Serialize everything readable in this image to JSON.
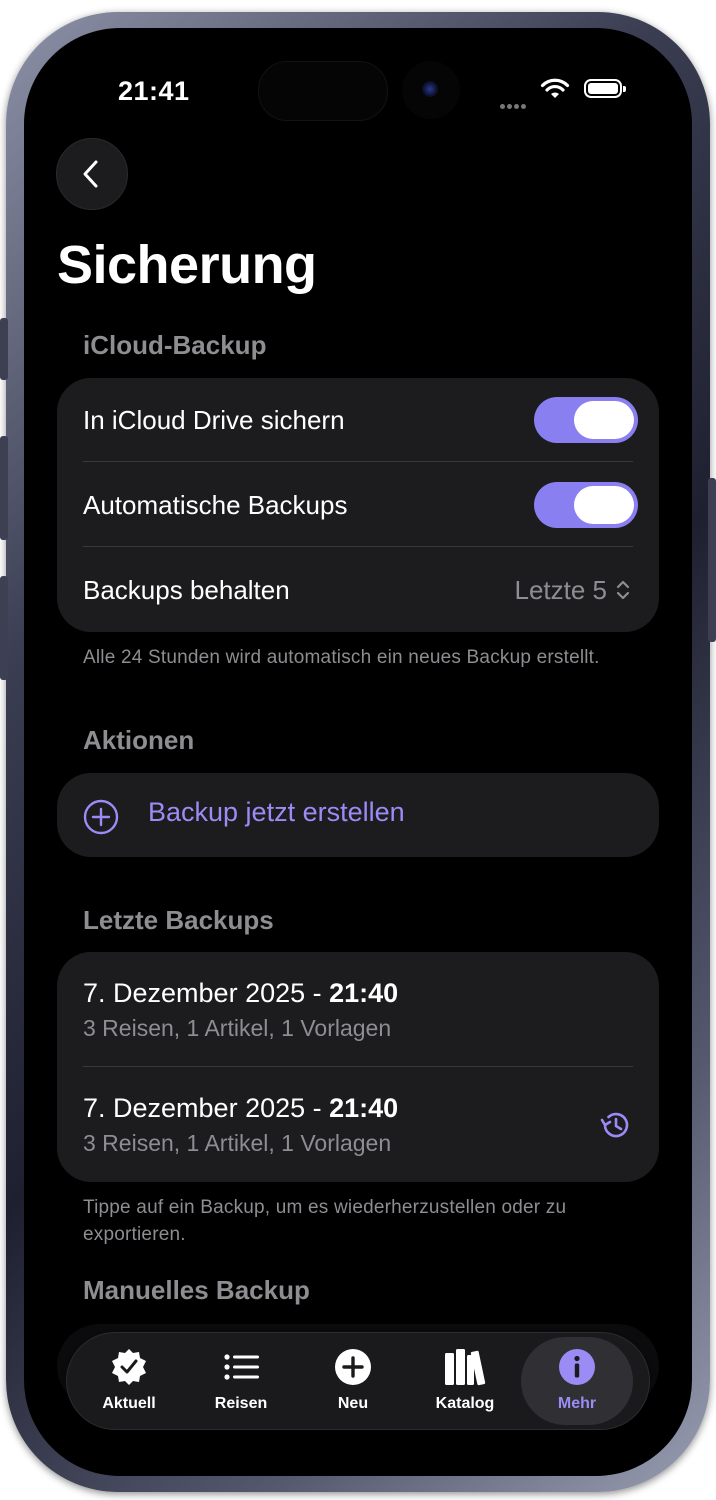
{
  "status_bar": {
    "time": "21:41"
  },
  "header": {
    "title": "Sicherung"
  },
  "icloud_section": {
    "header": "iCloud-Backup",
    "rows": [
      {
        "label": "In iCloud Drive sichern",
        "toggle_on": true
      },
      {
        "label": "Automatische Backups",
        "toggle_on": true
      }
    ],
    "keep": {
      "label": "Backups behalten",
      "value": "Letzte 5"
    },
    "footnote": "Alle 24 Stunden wird automatisch ein neues Backup erstellt."
  },
  "actions_section": {
    "header": "Aktionen",
    "create_label": "Backup jetzt erstellen"
  },
  "recent_section": {
    "header": "Letzte Backups",
    "items": [
      {
        "date": "7. Dezember 2025 - ",
        "time": "21:40",
        "details": "3 Reisen, 1 Artikel, 1 Vorlagen"
      },
      {
        "date": "7. Dezember 2025 - ",
        "time": "21:40",
        "details": "3 Reisen, 1 Artikel, 1 Vorlagen"
      }
    ],
    "footnote": "Tippe auf ein Backup, um es wiederherzustellen oder zu exportieren."
  },
  "manual_section": {
    "header": "Manuelles Backup"
  },
  "tab_bar": {
    "tabs": [
      {
        "label": "Aktuell",
        "icon": "checkmark-seal-icon",
        "active": false
      },
      {
        "label": "Reisen",
        "icon": "list-icon",
        "active": false
      },
      {
        "label": "Neu",
        "icon": "plus-circle-icon",
        "active": false
      },
      {
        "label": "Katalog",
        "icon": "books-icon",
        "active": false
      },
      {
        "label": "Mehr",
        "icon": "info-circle-icon",
        "active": true
      }
    ]
  },
  "colors": {
    "accent": "#9b8cf5",
    "toggle_on": "#8a7ff0",
    "card": "#1c1c1e",
    "secondary_text": "#8d8d92"
  }
}
